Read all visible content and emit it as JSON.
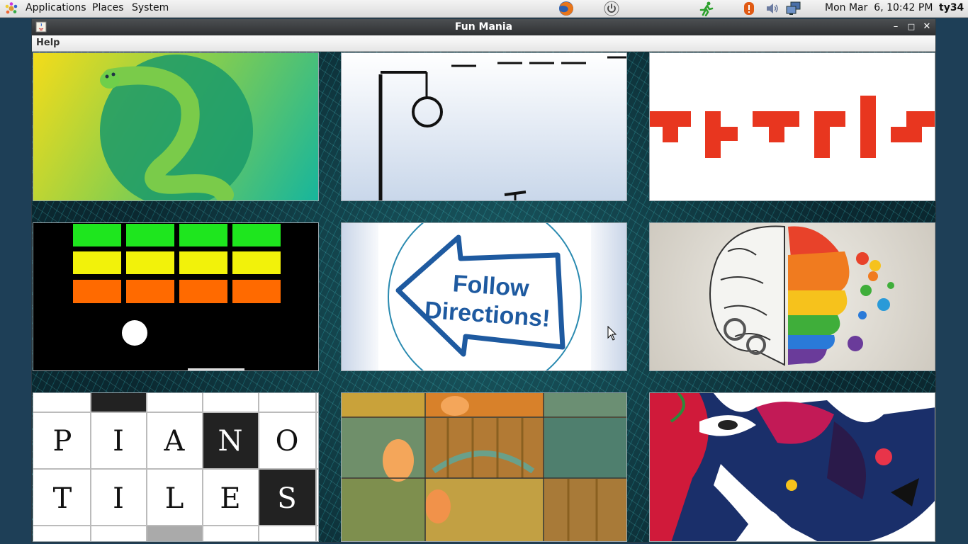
{
  "panel": {
    "menus": [
      "Applications",
      "Places",
      "System"
    ],
    "clock": "Mon Mar  6, 10:42 PM",
    "user": "ty34",
    "launchers": [
      "firefox-icon",
      "power-icon"
    ],
    "tray": [
      "run-icon",
      "alert-icon",
      "volume-icon",
      "network-icon"
    ]
  },
  "window": {
    "title": "Fun Mania",
    "menu": "Help",
    "controls": [
      "minimize-icon",
      "maximize-icon",
      "close-icon"
    ]
  },
  "tiles": {
    "follow_text_1": "Follow",
    "follow_text_2": "Directions!",
    "piano_row1": [
      "P",
      "I",
      "A",
      "N",
      "O"
    ],
    "piano_row2": [
      "T",
      "I",
      "L",
      "E",
      "S"
    ]
  }
}
